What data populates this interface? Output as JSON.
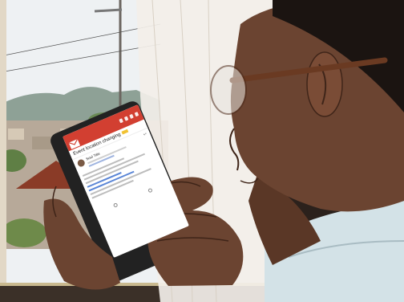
{
  "scene": {
    "description_free": true,
    "colors": {
      "sky": "#eef1f3",
      "hills": "#7d8f85",
      "window_frame": "#e8e0d2",
      "curtain": "#f4f0ea",
      "skin": "#6b4431",
      "skin_shadow": "#4a2c1e",
      "hair": "#1b1411",
      "glasses_frame": "#6a3a22",
      "shirt": "#d3e2e7",
      "phone_body": "#222222",
      "gmail_red": "#d23f31"
    }
  },
  "phone": {
    "app": "gmail",
    "subject": "Event location changing",
    "sender_name": "Soul Title",
    "icons": [
      "envelope-icon",
      "reply-icon",
      "archive-icon",
      "delete-icon",
      "more-icon"
    ]
  }
}
